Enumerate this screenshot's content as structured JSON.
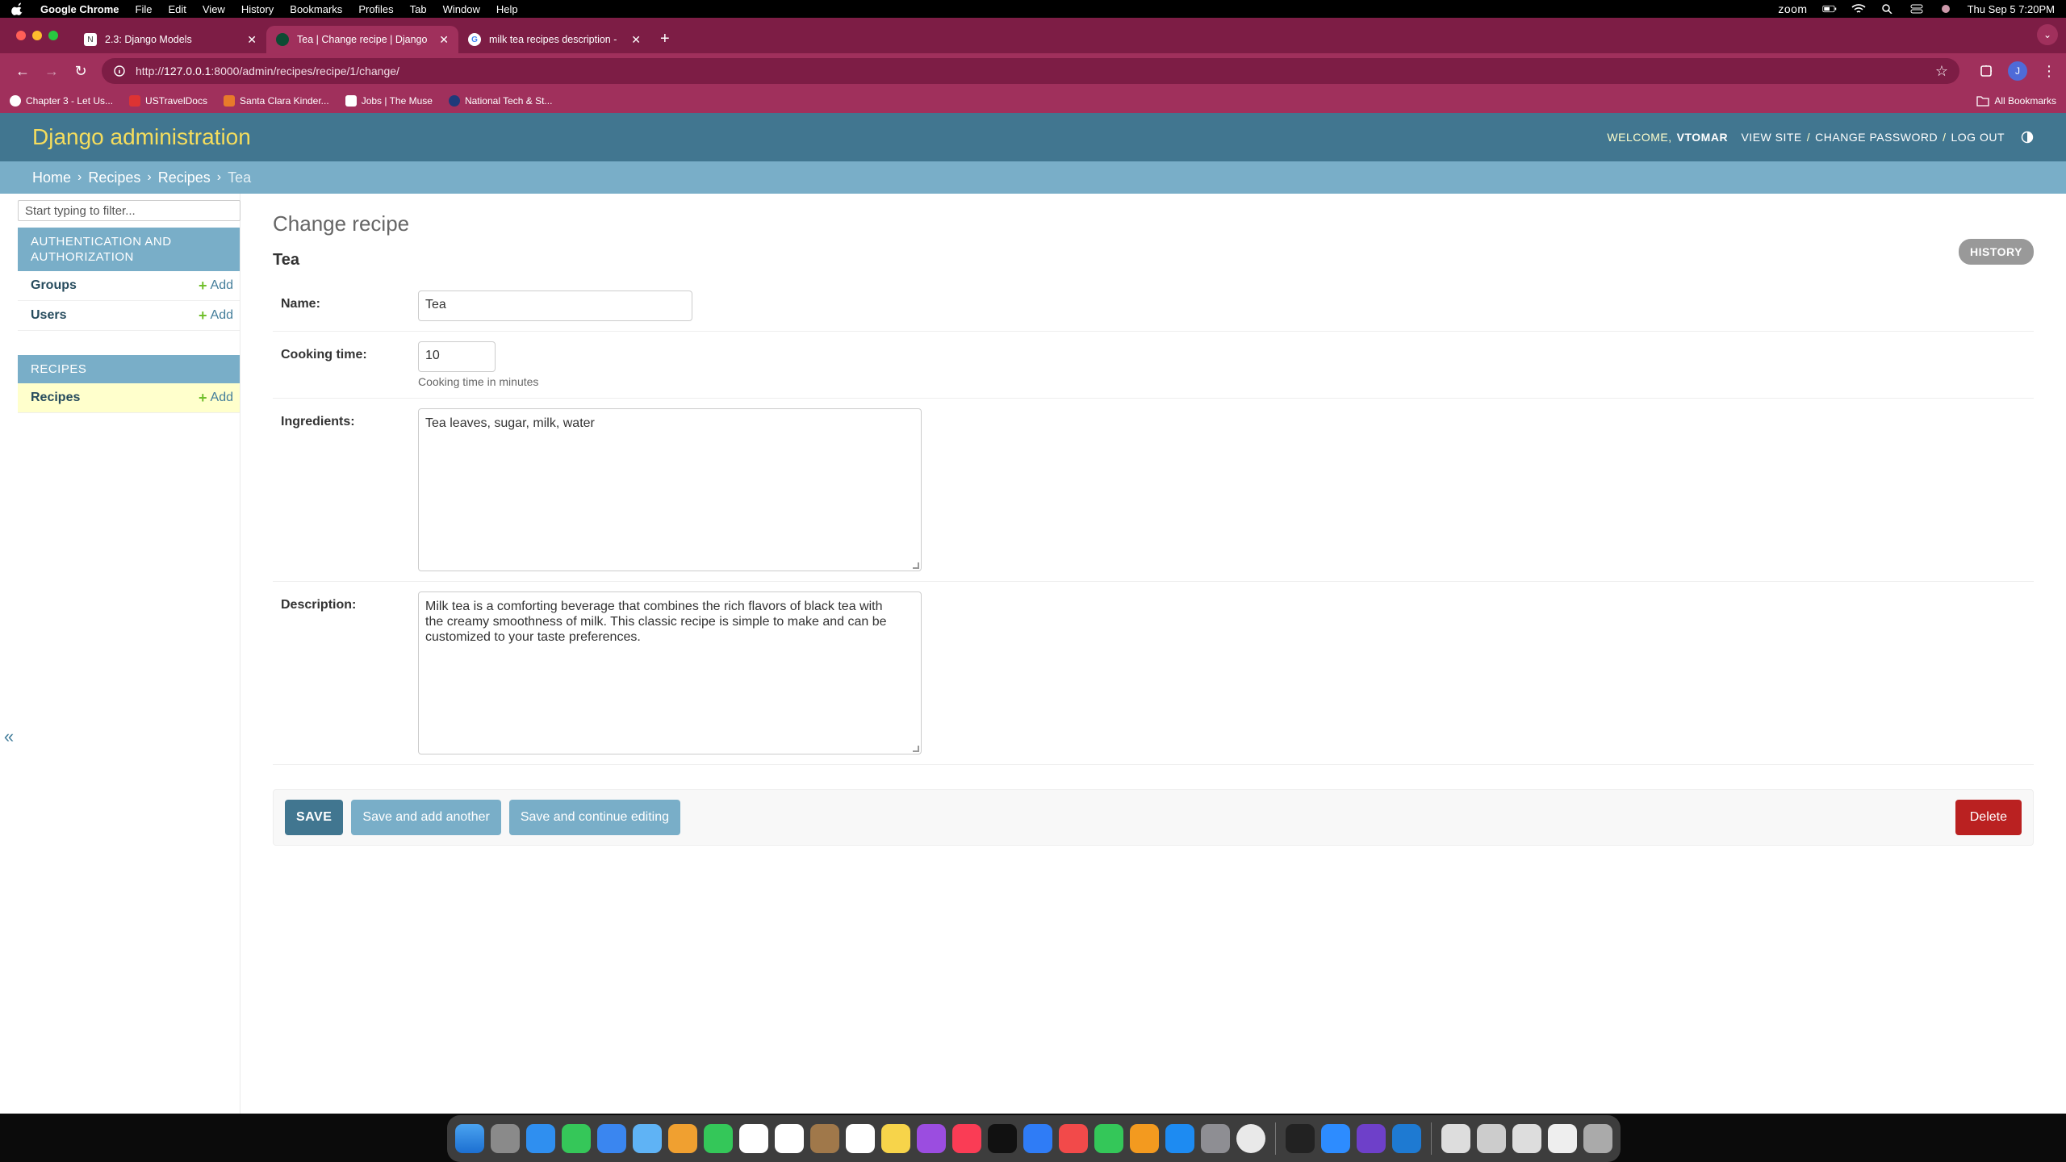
{
  "menubar": {
    "app": "Google Chrome",
    "items": [
      "File",
      "Edit",
      "View",
      "History",
      "Bookmarks",
      "Profiles",
      "Tab",
      "Window",
      "Help"
    ],
    "zoom": "zoom",
    "datetime": "Thu Sep 5  7:20PM"
  },
  "browser": {
    "tabs": [
      {
        "title": "2.3: Django Models",
        "active": false
      },
      {
        "title": "Tea | Change recipe | Django",
        "active": true
      },
      {
        "title": "milk tea recipes description -",
        "active": false
      }
    ],
    "url_scheme": "http://",
    "url_host": "127.0.0.1",
    "url_rest": ":8000/admin/recipes/recipe/1/change/",
    "bookmarks": [
      "Chapter 3 - Let Us...",
      "USTravelDocs",
      "Santa Clara Kinder...",
      "Jobs | The Muse",
      "National Tech & St..."
    ],
    "all_bookmarks": "All Bookmarks",
    "profile_initial": "J"
  },
  "header": {
    "brand": "Django administration",
    "welcome": "Welcome,",
    "username": "VTOMAR",
    "view_site": "View site",
    "change_password": "Change password",
    "log_out": "Log out",
    "sep": "/"
  },
  "breadcrumbs": {
    "home": "Home",
    "app": "Recipes",
    "model": "Recipes",
    "current": "Tea",
    "sep": "›"
  },
  "sidebar": {
    "filter_placeholder": "Start typing to filter...",
    "modules": [
      {
        "caption": "Authentication and Authorization",
        "rows": [
          {
            "label": "Groups",
            "add": "Add"
          },
          {
            "label": "Users",
            "add": "Add"
          }
        ]
      },
      {
        "caption": "Recipes",
        "rows": [
          {
            "label": "Recipes",
            "add": "Add"
          }
        ]
      }
    ],
    "toggle": "«"
  },
  "content": {
    "title": "Change recipe",
    "object_name": "Tea",
    "history": "History",
    "fields": {
      "name": {
        "label": "Name:",
        "value": "Tea"
      },
      "cooking_time": {
        "label": "Cooking time:",
        "value": "10",
        "help": "Cooking time in minutes"
      },
      "ingredients": {
        "label": "Ingredients:",
        "value": "Tea leaves, sugar, milk, water"
      },
      "description": {
        "label": "Description:",
        "value": "Milk tea is a comforting beverage that combines the rich flavors of black tea with\nthe creamy smoothness of milk. This classic recipe is simple to make and can be\ncustomized to your taste preferences."
      }
    },
    "buttons": {
      "save": "Save",
      "save_add": "Save and add another",
      "save_continue": "Save and continue editing",
      "delete": "Delete"
    }
  },
  "colors": {
    "django_header": "#417690",
    "django_breadcrumbs": "#79aec8",
    "django_brand": "#f5dd5d",
    "chrome_frame": "#a0305c",
    "delete": "#ba2121"
  }
}
